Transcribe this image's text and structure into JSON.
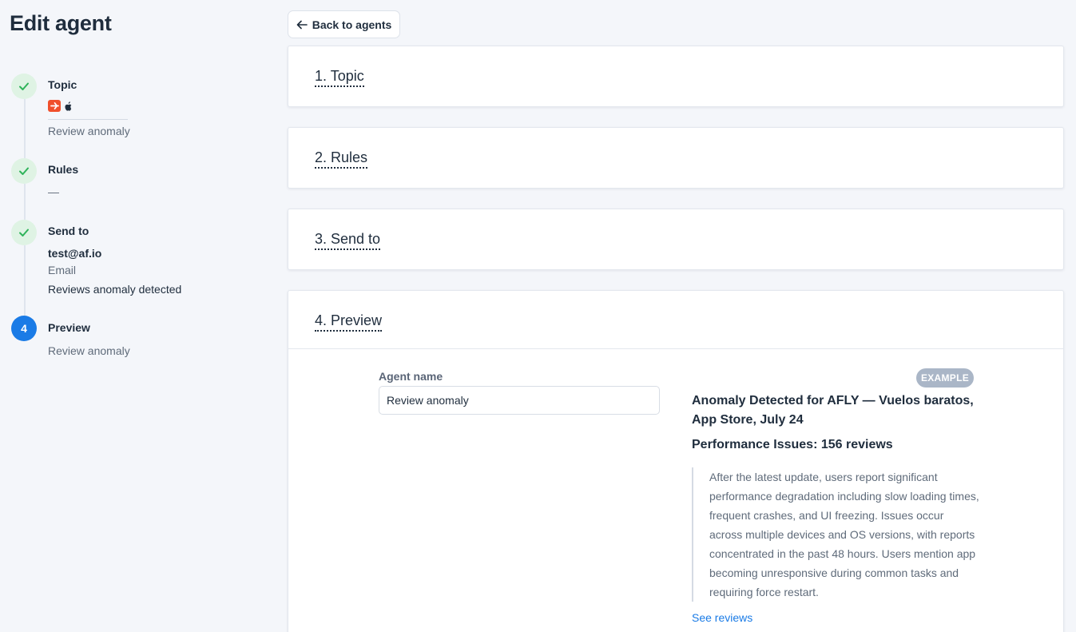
{
  "sidebar": {
    "title": "Edit agent",
    "steps": [
      {
        "label": "Topic",
        "status": "done",
        "subtitle": "Review anomaly"
      },
      {
        "label": "Rules",
        "status": "done",
        "subtitle": "—"
      },
      {
        "label": "Send to",
        "status": "done",
        "recipient": "test@af.io",
        "channel": "Email",
        "event": "Reviews anomaly detected"
      },
      {
        "label": "Preview",
        "status": "active",
        "number": "4",
        "subtitle": "Review anomaly"
      }
    ],
    "topic_icons": [
      "plane-app-icon",
      "apple-icon"
    ]
  },
  "back_button": {
    "label": "Back to agents",
    "icon": "arrow-left-icon"
  },
  "sections": [
    {
      "title": "1. Topic"
    },
    {
      "title": "2. Rules"
    },
    {
      "title": "3. Send to"
    },
    {
      "title": "4. Preview"
    }
  ],
  "preview": {
    "agent_name_label": "Agent name",
    "agent_name_value": "Review anomaly",
    "badge": "EXAMPLE",
    "heading": "Anomaly Detected for AFLY — Vuelos baratos, App Store, July 24",
    "subheading": "Performance Issues: 156 reviews",
    "body": "After the latest update, users report significant performance degradation including slow loading times, frequent crashes, and UI freezing. Issues occur across multiple devices and OS versions, with reports concentrated in the past 48 hours. Users mention app becoming unresponsive during common tasks and requiring force restart.",
    "link": "See reviews"
  },
  "colors": {
    "accent": "#1a7be6",
    "success": "#2fb35a",
    "success_bg": "#dff3e4",
    "app_icon": "#f0502c",
    "badge_bg": "#aab6c7"
  }
}
